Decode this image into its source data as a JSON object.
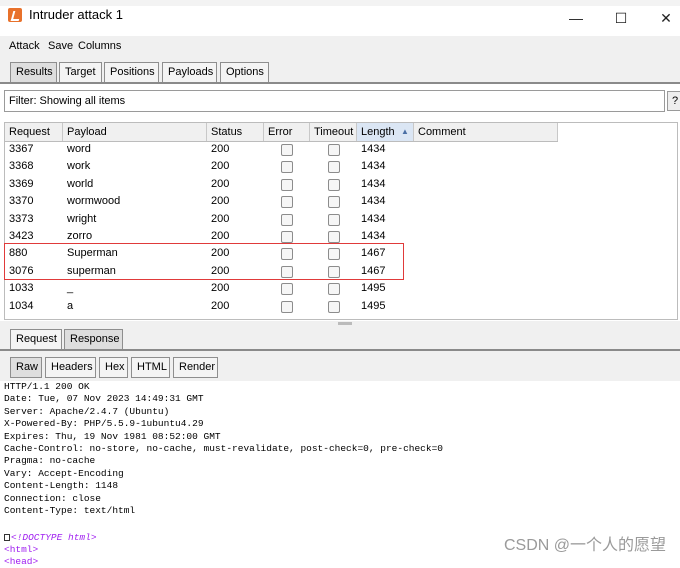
{
  "window": {
    "title": "Intruder attack 1",
    "minimize": "—",
    "maximize": "☐",
    "close": "✕"
  },
  "menu": [
    "Attack",
    "Save",
    "Columns"
  ],
  "main_tabs": [
    {
      "label": "Results",
      "active": true
    },
    {
      "label": "Target",
      "active": false
    },
    {
      "label": "Positions",
      "active": false
    },
    {
      "label": "Payloads",
      "active": false
    },
    {
      "label": "Options",
      "active": false
    }
  ],
  "filter": {
    "text": "Filter: Showing all items",
    "help": "?"
  },
  "table": {
    "columns": [
      "Request",
      "Payload",
      "Status",
      "Error",
      "Timeout",
      "Length",
      "Comment"
    ],
    "sort_column": "Length",
    "sort_indicator": "▲",
    "rows": [
      {
        "request": "3367",
        "payload": "word",
        "status": "200",
        "length": "1434"
      },
      {
        "request": "3368",
        "payload": "work",
        "status": "200",
        "length": "1434"
      },
      {
        "request": "3369",
        "payload": "world",
        "status": "200",
        "length": "1434"
      },
      {
        "request": "3370",
        "payload": "wormwood",
        "status": "200",
        "length": "1434"
      },
      {
        "request": "3373",
        "payload": "wright",
        "status": "200",
        "length": "1434"
      },
      {
        "request": "3423",
        "payload": "zorro",
        "status": "200",
        "length": "1434"
      },
      {
        "request": "880",
        "payload": "Superman",
        "status": "200",
        "length": "1467"
      },
      {
        "request": "3076",
        "payload": "superman",
        "status": "200",
        "length": "1467"
      },
      {
        "request": "1033",
        "payload": "_",
        "status": "200",
        "length": "1495"
      },
      {
        "request": "1034",
        "payload": "a",
        "status": "200",
        "length": "1495"
      }
    ]
  },
  "reqres_tabs": [
    {
      "label": "Request",
      "active": false
    },
    {
      "label": "Response",
      "active": true
    }
  ],
  "view_tabs": [
    {
      "label": "Raw",
      "active": true
    },
    {
      "label": "Headers",
      "active": false
    },
    {
      "label": "Hex",
      "active": false
    },
    {
      "label": "HTML",
      "active": false
    },
    {
      "label": "Render",
      "active": false
    }
  ],
  "response": {
    "headers": [
      "HTTP/1.1 200 OK",
      "Date: Tue, 07 Nov 2023 14:49:31 GMT",
      "Server: Apache/2.4.7 (Ubuntu)",
      "X-Powered-By: PHP/5.5.9-1ubuntu4.29",
      "Expires: Thu, 19 Nov 1981 08:52:00 GMT",
      "Cache-Control: no-store, no-cache, must-revalidate, post-check=0, pre-check=0",
      "Pragma: no-cache",
      "Vary: Accept-Encoding",
      "Content-Length: 1148",
      "Connection: close",
      "Content-Type: text/html"
    ],
    "doctype": "<!DOCTYPE html>",
    "html_tag": "<html>",
    "head_tag": "<head>"
  },
  "watermark": "CSDN @一个人的愿望"
}
